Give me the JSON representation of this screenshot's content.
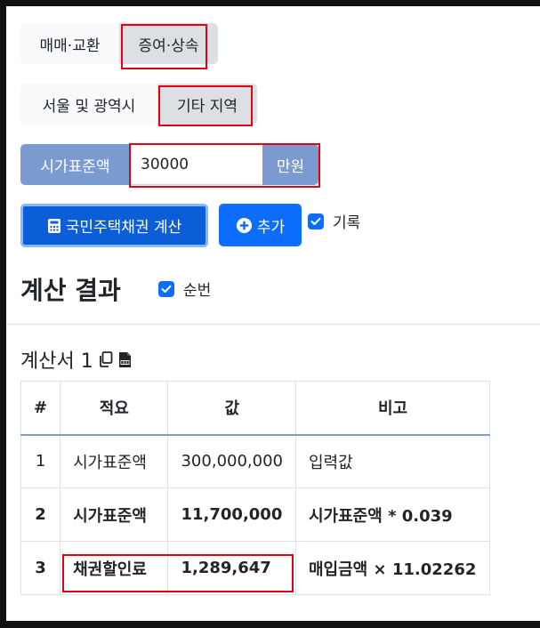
{
  "tabs_trade": {
    "items": [
      "매매·교환",
      "증여·상속"
    ],
    "active": 1
  },
  "tabs_region": {
    "items": [
      "서울 및 광역시",
      "기타 지역"
    ],
    "active": 1
  },
  "price_input": {
    "label": "시가표준액",
    "value": "30000",
    "unit": "만원"
  },
  "actions": {
    "calc_label": "국민주택채권 계산",
    "add_label": "추가",
    "record_label": "기록"
  },
  "result": {
    "heading": "계산 결과",
    "order_label": "순번",
    "sheet_title": "계산서 1"
  },
  "table": {
    "headers": [
      "#",
      "적요",
      "값",
      "비고"
    ],
    "rows": [
      [
        "1",
        "시가표준액",
        "300,000,000",
        "입력값"
      ],
      [
        "2",
        "시가표준액",
        "11,700,000",
        "시가표준액 * 0.039"
      ],
      [
        "3",
        "채권할인료",
        "1,289,647",
        "매입금액 × 11.02262"
      ]
    ]
  },
  "icons": {
    "calc": "calculator-icon",
    "add": "plus-circle-icon",
    "copy": "copy-icon",
    "csv": "csv-file-icon"
  },
  "colors": {
    "primary": "#0d6efd",
    "input_addon": "#7b9ad0",
    "highlight": "#e60012"
  }
}
